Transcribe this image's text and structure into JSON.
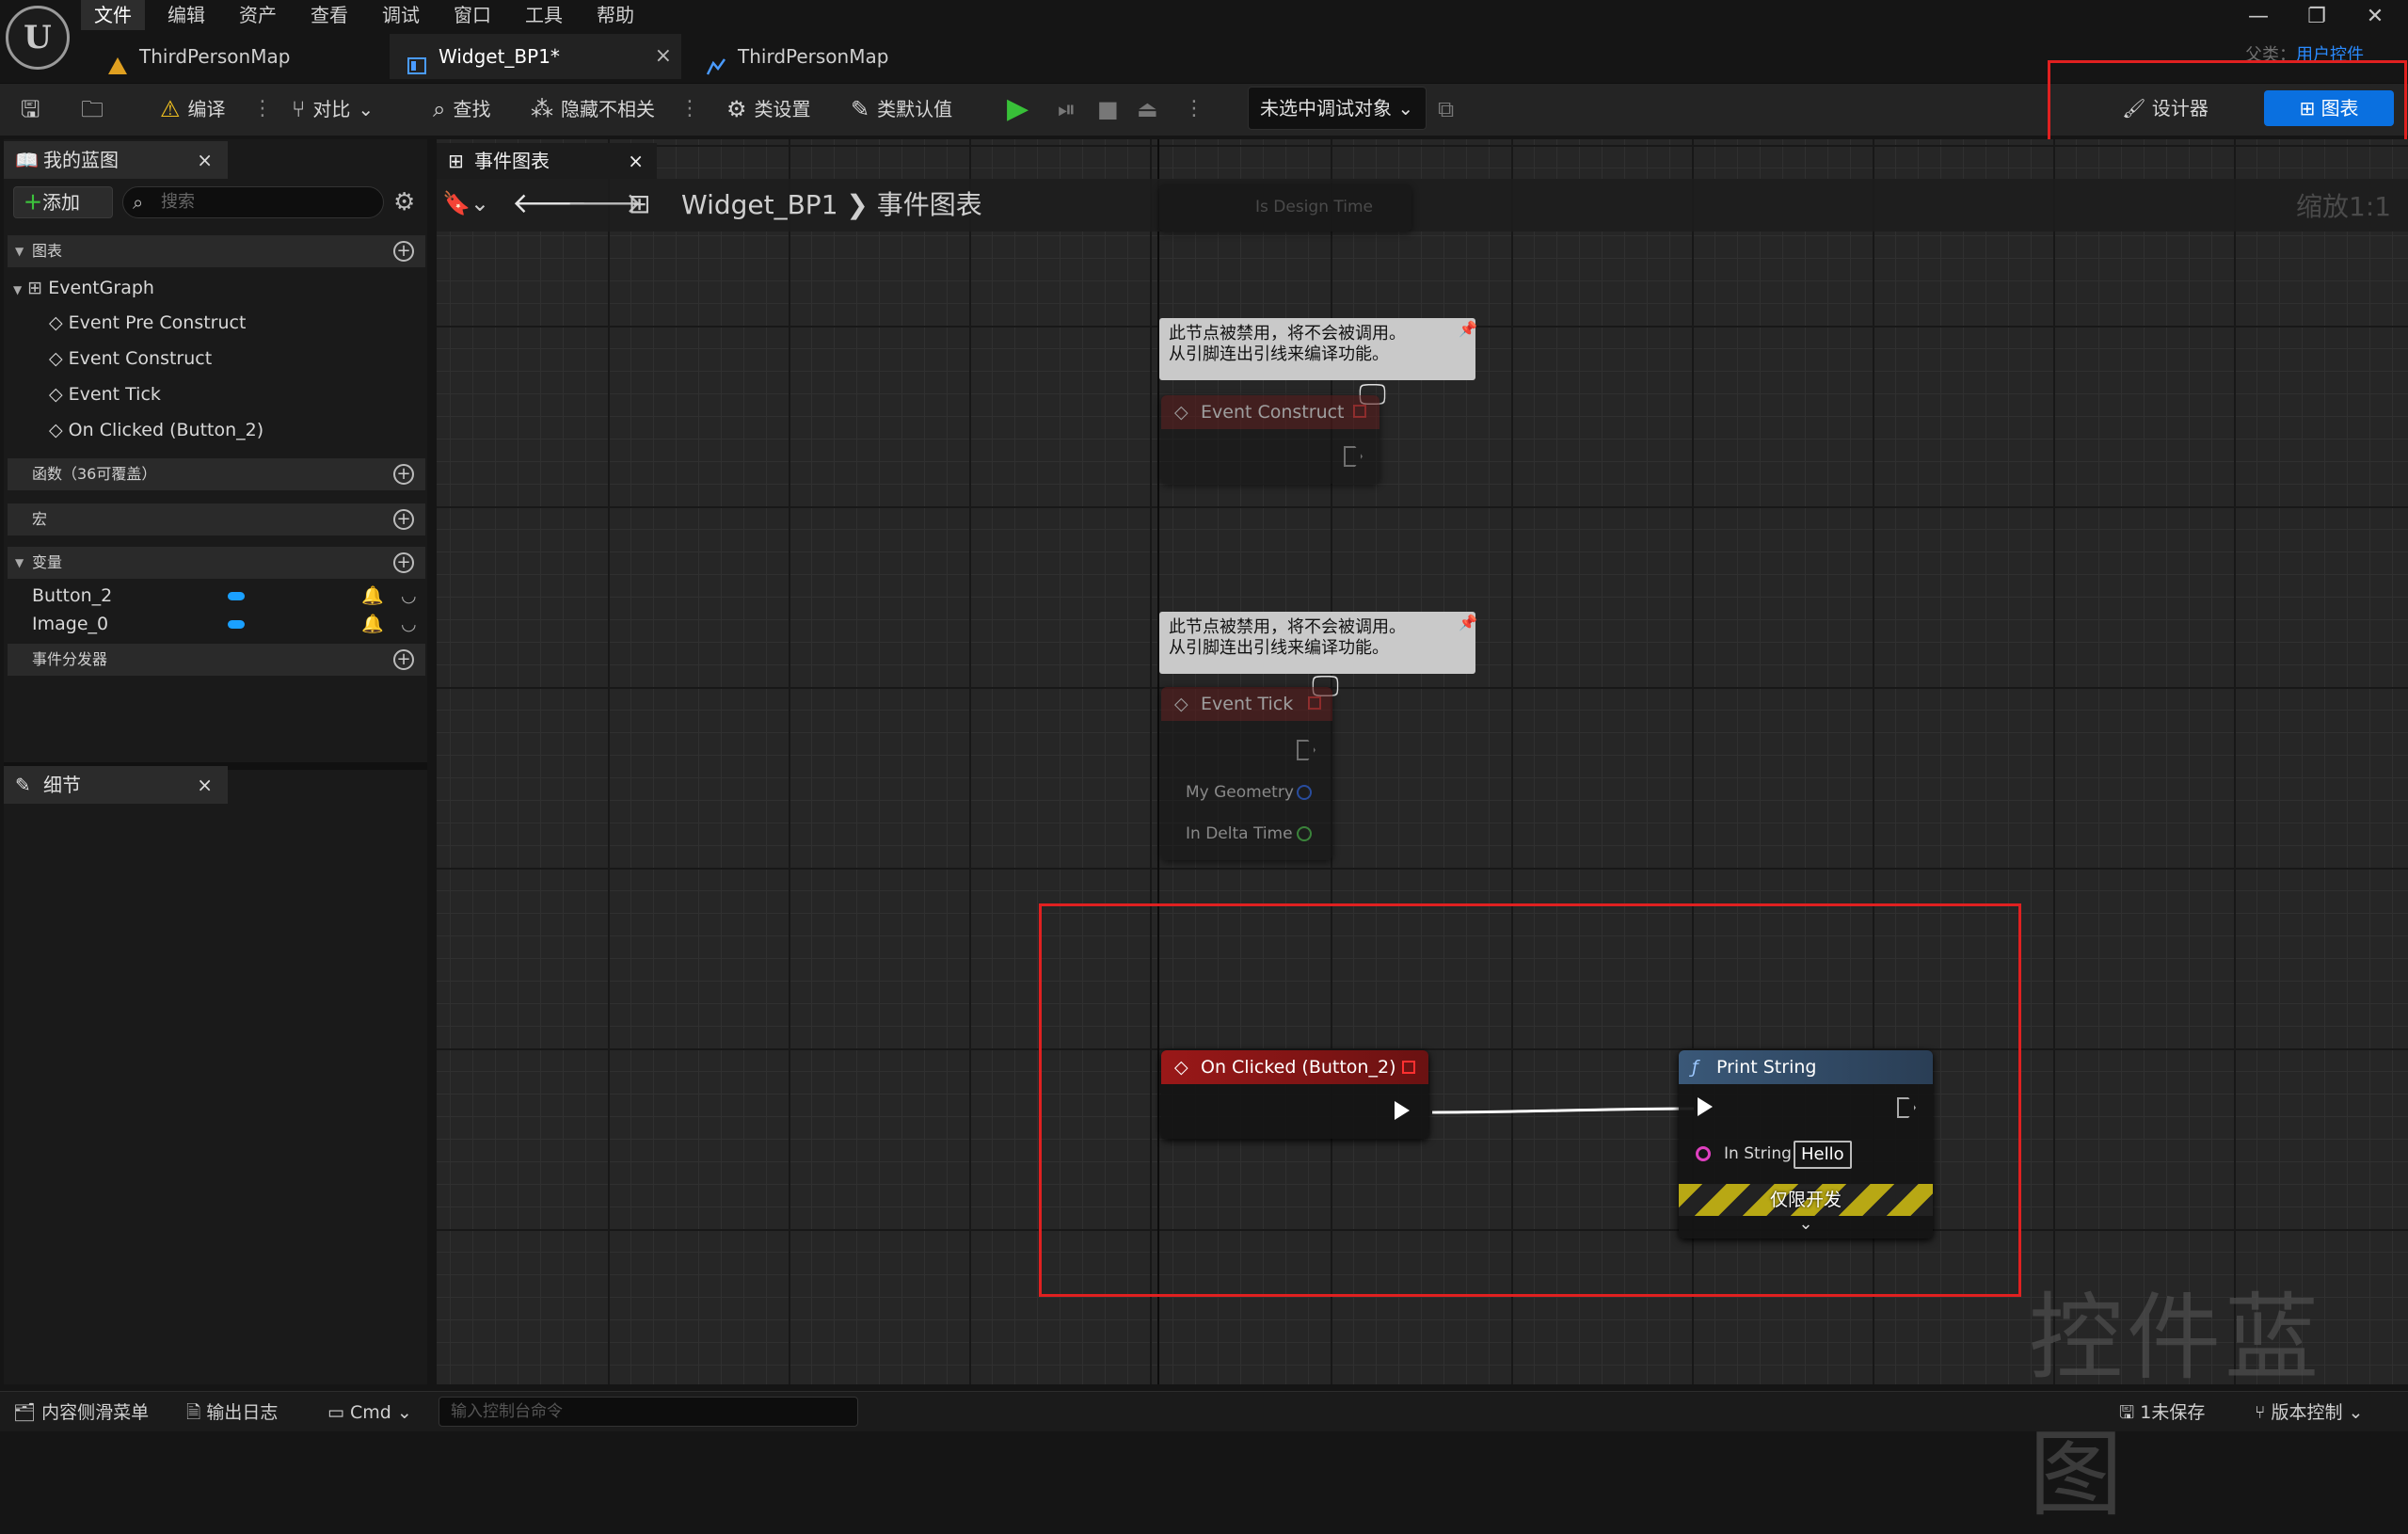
{
  "app": {
    "logo_letter": "U"
  },
  "menu": [
    "文件",
    "编辑",
    "资产",
    "查看",
    "调试",
    "窗口",
    "工具",
    "帮助"
  ],
  "window_controls": {
    "minimize": "—",
    "restore": "❐",
    "close": "✕"
  },
  "doc_tabs": [
    {
      "label": "ThirdPersonMap"
    },
    {
      "label": "Widget_BP1*",
      "close": "×"
    },
    {
      "label": "ThirdPersonMap"
    }
  ],
  "breadcrumb_right": {
    "parent": "父类：",
    "value": "用户控件"
  },
  "toolbar": {
    "compile": "编译",
    "diff": "对比",
    "find": "查找",
    "hide_unrelated": "隐藏不相关",
    "class_settings": "类设置",
    "class_defaults": "类默认值",
    "debug_object": "未选中调试对象",
    "designer": "设计器",
    "graph": "图表"
  },
  "my_blueprint": {
    "title": "我的蓝图",
    "add": "添加",
    "search_placeholder": "搜索",
    "sections": {
      "graphs": "图表",
      "functions": "函数（36可覆盖）",
      "macros": "宏",
      "variables": "变量",
      "dispatchers": "事件分发器"
    },
    "event_graph": "EventGraph",
    "events": [
      "Event Pre Construct",
      "Event Construct",
      "Event Tick",
      "On Clicked (Button_2)"
    ],
    "variables": [
      "Button_2",
      "Image_0"
    ]
  },
  "details": {
    "title": "细节"
  },
  "graph_tab": {
    "label": "事件图表"
  },
  "graph_breadcrumb": {
    "blueprint": "Widget_BP1",
    "graph": "事件图表"
  },
  "zoom": "缩放1:1",
  "nodes": {
    "top_partial_pin": "Is Design Time",
    "disabled_comment": "此节点被禁用，将不会被调用。\n从引脚连出引线来编译功能。",
    "event_construct": "Event Construct",
    "event_tick": "Event Tick",
    "tick_pins": [
      "My Geometry",
      "In Delta Time"
    ],
    "on_clicked": "On Clicked (Button_2)",
    "print_string": "Print String",
    "in_string_label": "In String",
    "in_string_value": "Hello",
    "dev_only": "仅限开发"
  },
  "watermark": "控件蓝图",
  "bottom_bar": {
    "content_drawer": "内容侧滑菜单",
    "output_log": "输出日志",
    "cmd": "Cmd",
    "cmd_placeholder": "输入控制台命令",
    "unsaved": "1未保存",
    "source_control": "版本控制"
  },
  "colors": {
    "accent_blue": "#0a70e0",
    "event_header_red": "#8a1a1a",
    "function_header_blue": "#3c5a78",
    "highlight_red": "#e02020"
  }
}
